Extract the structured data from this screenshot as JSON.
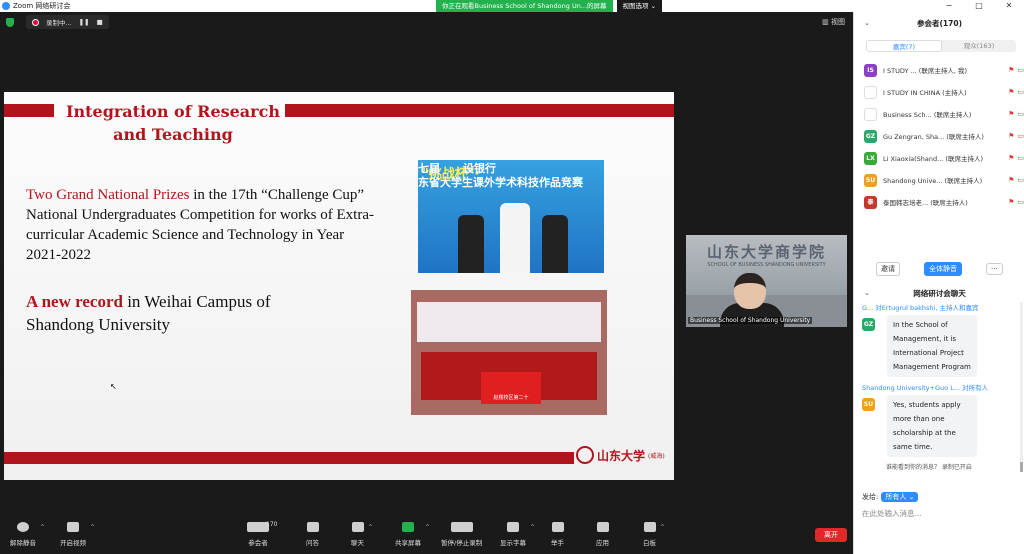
{
  "window": {
    "title": "Zoom 网络研讨会",
    "minimize": "−",
    "maximize": "□",
    "close": "✕"
  },
  "share_banner": {
    "text": "你正在观看Business School of Shandong Un...的屏幕",
    "options": "视图选项 ⌄"
  },
  "recording": {
    "label": "录制中...",
    "pause": "❚❚",
    "stop": "■"
  },
  "view_button": "▥ 视图",
  "slide": {
    "title_line1": "Integration of  Research",
    "title_line2": "and Teaching",
    "para1_red": "Two Grand National Prizes",
    "para1_rest": " in the 17th “Challenge Cup” National Undergraduates Competition for works of Extra-curricular Academic Science and Technology in Year 2021-2022",
    "para2_red": "A new record",
    "para2_rest": " in Weihai Campus of Shandong University",
    "photo1_yellow": "\"挑战杯\"·",
    "photo1_white": "七届      设银行\n东省大学生课外学术科技作品竞赛",
    "photo2_flag": "赵楼校区第二十",
    "logo_name": "山东大学",
    "logo_sub": "(威海)"
  },
  "video": {
    "wall_cn": "山东大学商学院",
    "wall_en": "SCHOOL OF BUSINESS SHANDONG UNIVERSITY",
    "name": "Business School of Shandong University"
  },
  "toolbar": {
    "mute": "解除静音",
    "video": "开启视频",
    "participants": "参会者",
    "participants_count": "170",
    "qa": "问答",
    "chat": "聊天",
    "share": "共享屏幕",
    "pause_rec": "暂停/停止录制",
    "captions": "显示字幕",
    "raise": "举手",
    "apps": "应用",
    "whiteboard": "白板",
    "leave": "离开"
  },
  "participants": {
    "header": "参会者(170)",
    "tab_panelists": "嘉宾(7)",
    "tab_attendees": "观众(163)",
    "list": [
      {
        "initials": "IS",
        "color": "#8b3fc8",
        "name": "I STUDY ... (联席主持人, 我)"
      },
      {
        "initials": "",
        "color": "#ffffff",
        "name": "I STUDY IN CHINA (主持人)"
      },
      {
        "initials": "",
        "color": "#ffffff",
        "name": "Business Sch... (联席主持人)"
      },
      {
        "initials": "GZ",
        "color": "#2aa86a",
        "name": "Gu Zengran, Sha... (联席主持人)"
      },
      {
        "initials": "LX",
        "color": "#3aa83a",
        "name": "Li Xiaoxia(Shand... (联席主持人)"
      },
      {
        "initials": "SU",
        "color": "#f0a020",
        "name": "Shandong Unive... (联席主持人)"
      },
      {
        "initials": "泰",
        "color": "#c0392b",
        "name": "泰国韩志培老... (联席主持人)"
      }
    ],
    "invite": "邀请",
    "mute_all": "全体静音",
    "more": "···"
  },
  "chat": {
    "header": "网络研讨会聊天",
    "messages": [
      {
        "sender": "G... 对Ertugrul bakhshi, 主持人和嘉宾",
        "initials": "GZ",
        "color": "#2aa86a",
        "text": "In the School of Management, it is International Project Management Program"
      },
      {
        "sender": "Shandong University+Guo L... 对所有人",
        "initials": "SU",
        "color": "#f0a020",
        "text": "Yes, students apply more than one scholarship at the same time."
      }
    ],
    "notice": "谁能看到你的消息？ 录制已开启",
    "to_label": "发给:",
    "to_value": "所有人 ⌄",
    "input_placeholder": "在此处输入消息..."
  }
}
